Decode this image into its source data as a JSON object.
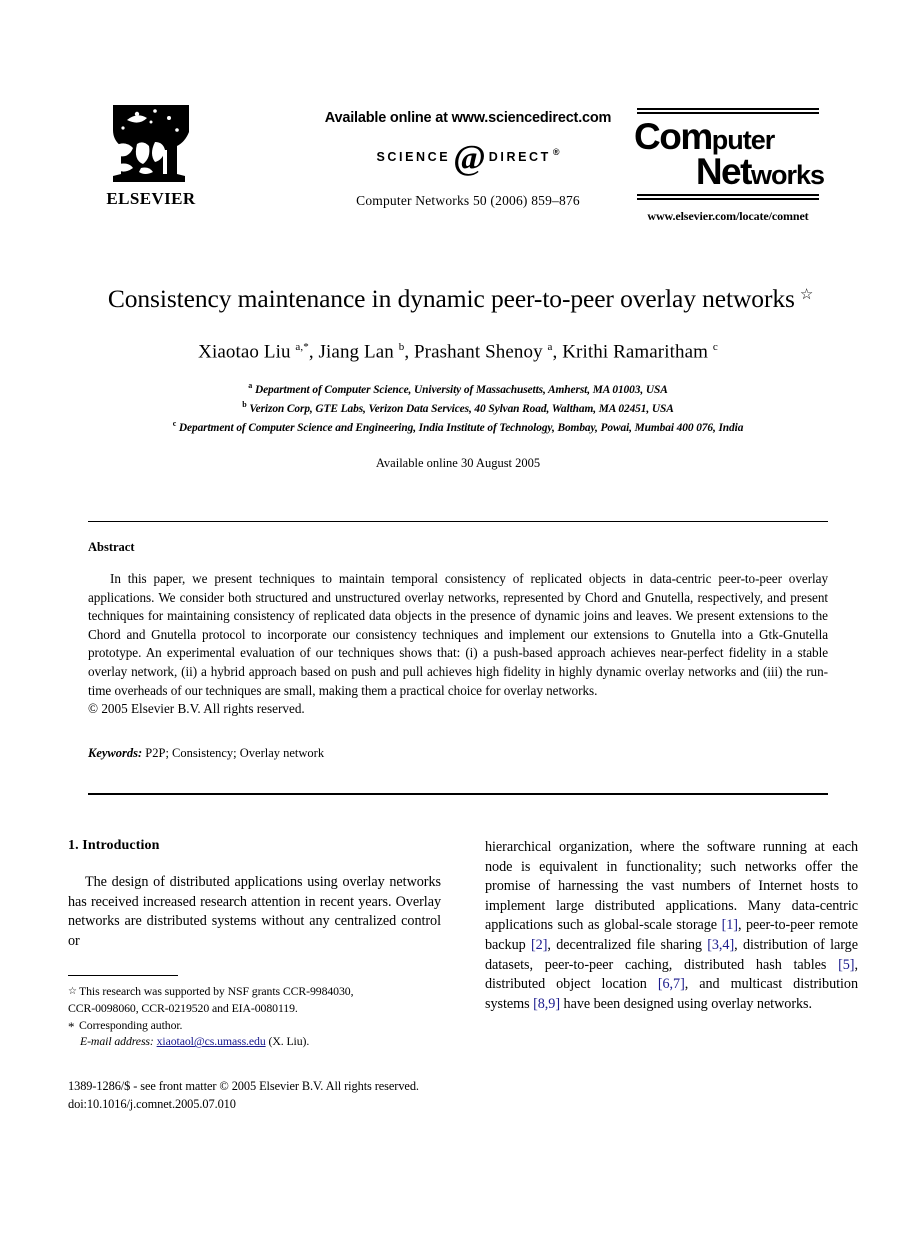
{
  "masthead": {
    "elsevier_wordmark": "ELSEVIER",
    "elsevier_logo_icon": "elsevier-tree-icon",
    "available_online": "Available online at www.sciencedirect.com",
    "sciencedirect_left": "SCIENCE",
    "sciencedirect_at": "@",
    "sciencedirect_right": "DIRECT",
    "sciencedirect_reg": "®",
    "journal_reference": "Computer Networks 50 (2006) 859–876",
    "journal_logo_line1_a": "Com",
    "journal_logo_line1_b": "puter",
    "journal_logo_line2_a": "Net",
    "journal_logo_line2_b": "works",
    "journal_url": "www.elsevier.com/locate/comnet"
  },
  "title_block": {
    "title": "Consistency maintenance in dynamic peer-to-peer overlay networks",
    "title_footnote_marker": "☆",
    "authors_html": "Xiaotao Liu <sup>a,*</sup>, Jiang Lan <sup>b</sup>, Prashant Shenoy <sup>a</sup>, Krithi Ramaritham <sup>c</sup>",
    "authors_plain": "Xiaotao Liu a,*, Jiang Lan b, Prashant Shenoy a, Krithi Ramaritham c",
    "affiliations": [
      {
        "marker": "a",
        "text": "Department of Computer Science, University of Massachusetts, Amherst, MA 01003, USA"
      },
      {
        "marker": "b",
        "text": "Verizon Corp, GTE Labs, Verizon Data Services, 40 Sylvan Road, Waltham, MA 02451, USA"
      },
      {
        "marker": "c",
        "text": "Department of Computer Science and Engineering, India Institute of Technology, Bombay, Powai, Mumbai 400 076, India"
      }
    ],
    "available_online_date": "Available online 30 August 2005"
  },
  "abstract": {
    "heading": "Abstract",
    "body": "In this paper, we present techniques to maintain temporal consistency of replicated objects in data-centric peer-to-peer overlay applications. We consider both structured and unstructured overlay networks, represented by Chord and Gnutella, respectively, and present techniques for maintaining consistency of replicated data objects in the presence of dynamic joins and leaves. We present extensions to the Chord and Gnutella protocol to incorporate our consistency techniques and implement our extensions to Gnutella into a Gtk-Gnutella prototype. An experimental evaluation of our techniques shows that: (i) a push-based approach achieves near-perfect fidelity in a stable overlay network, (ii) a hybrid approach based on push and pull achieves high fidelity in highly dynamic overlay networks and (iii) the run-time overheads of our techniques are small, making them a practical choice for overlay networks.",
    "copyright": "© 2005 Elsevier B.V. All rights reserved.",
    "keywords_label": "Keywords:",
    "keywords_value": "P2P; Consistency; Overlay network"
  },
  "body": {
    "section_number_title": "1. Introduction",
    "left_paragraph": "The design of distributed applications using overlay networks has received increased research attention in recent years. Overlay networks are distributed systems without any centralized control or",
    "right_paragraph_parts": [
      {
        "type": "text",
        "value": "hierarchical organization, where the software running at each node is equivalent in functionality; such networks offer the promise of harnessing the vast numbers of Internet hosts to implement large distributed applications. Many data-centric applications such as global-scale storage "
      },
      {
        "type": "cite",
        "value": "[1]"
      },
      {
        "type": "text",
        "value": ", peer-to-peer remote backup "
      },
      {
        "type": "cite",
        "value": "[2]"
      },
      {
        "type": "text",
        "value": ", decentralized file sharing "
      },
      {
        "type": "cite",
        "value": "[3,4]"
      },
      {
        "type": "text",
        "value": ", distribution of large datasets, peer-to-peer caching, distributed hash tables "
      },
      {
        "type": "cite",
        "value": "[5]"
      },
      {
        "type": "text",
        "value": ", distributed object location "
      },
      {
        "type": "cite",
        "value": "[6,7]"
      },
      {
        "type": "text",
        "value": ", and multicast distribution systems "
      },
      {
        "type": "cite",
        "value": "[8,9]"
      },
      {
        "type": "text",
        "value": " have been designed using overlay networks."
      }
    ]
  },
  "footnotes": {
    "grant_marker": "☆",
    "grant_line1": "This research was supported by NSF grants CCR-9984030,",
    "grant_line2": "CCR-0098060, CCR-0219520 and EIA-0080119.",
    "corresponding_marker": "*",
    "corresponding_text": "Corresponding author.",
    "email_label": "E-mail address:",
    "email_value": "xiaotaol@cs.umass.edu",
    "email_suffix": "(X. Liu)."
  },
  "page_footer": {
    "front_matter": "1389-1286/$ - see front matter © 2005 Elsevier B.V. All rights reserved.",
    "doi": "doi:10.1016/j.comnet.2005.07.010"
  },
  "colors": {
    "citation_link": "#1a1a8c",
    "email_link": "#16168c",
    "text": "#000000",
    "background": "#ffffff"
  }
}
